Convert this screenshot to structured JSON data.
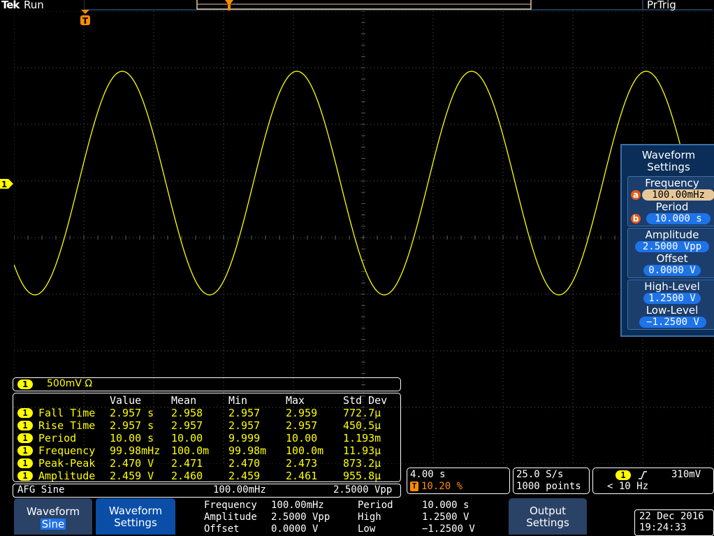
{
  "header": {
    "brand": "Tek",
    "run_state": "Run",
    "trigger_mode": "PrTrig"
  },
  "trigger_marker": "T",
  "channel1_marker": "1",
  "colors": {
    "trace": "#ffff00",
    "grid": "#5a5a5a",
    "menu_bg": "#0a2e58",
    "accent": "#1e73e8",
    "knob": "#e85a16"
  },
  "scale_bar": {
    "channel": "1",
    "scale": "500mV Ω"
  },
  "measurements": {
    "headers": [
      "Value",
      "Mean",
      "Min",
      "Max",
      "Std Dev"
    ],
    "rows": [
      {
        "channel": "1",
        "name": "Fall Time",
        "value": "2.957 s",
        "mean": "2.958",
        "min": "2.957",
        "max": "2.959",
        "std": "772.7µ"
      },
      {
        "channel": "1",
        "name": "Rise Time",
        "value": "2.957 s",
        "mean": "2.957",
        "min": "2.957",
        "max": "2.957",
        "std": "450.5µ"
      },
      {
        "channel": "1",
        "name": "Period",
        "value": "10.00 s",
        "mean": "10.00",
        "min": "9.999",
        "max": "10.00",
        "std": "1.193m"
      },
      {
        "channel": "1",
        "name": "Frequency",
        "value": "99.98mHz",
        "mean": "100.0m",
        "min": "99.98m",
        "max": "100.0m",
        "std": "11.93µ"
      },
      {
        "channel": "1",
        "name": "Peak-Peak",
        "value": "2.470 V",
        "mean": "2.471",
        "min": "2.470",
        "max": "2.473",
        "std": "873.2µ"
      },
      {
        "channel": "1",
        "name": "Amplitude",
        "value": "2.459 V",
        "mean": "2.460",
        "min": "2.459",
        "max": "2.461",
        "std": "955.8µ"
      }
    ]
  },
  "afg_bar": {
    "label": "AFG Sine",
    "frequency": "100.00mHz",
    "amplitude": "2.5000 Vpp"
  },
  "timebase": {
    "scale": "4.00 s",
    "trigger_marker": "T",
    "trigger_position": "10.20 %"
  },
  "acquisition": {
    "sample_rate": "25.0 S/s",
    "record_length": "1000 points"
  },
  "trigger": {
    "channel": "1",
    "slope_icon": "rising-edge",
    "level": "310mV",
    "freq": "< 10 Hz"
  },
  "bottom": {
    "waveform_label": "Waveform",
    "waveform_value": "Sine",
    "waveform_settings": [
      "Waveform",
      "Settings"
    ],
    "params": [
      {
        "label": "Frequency",
        "value": "100.00mHz"
      },
      {
        "label": "Amplitude",
        "value": "2.5000 Vpp"
      },
      {
        "label": "Offset",
        "value": "0.0000 V"
      }
    ],
    "params2": [
      {
        "label": "Period",
        "value": "10.000 s"
      },
      {
        "label": "High",
        "value": "1.2500 V"
      },
      {
        "label": "Low",
        "value": "−1.2500 V"
      }
    ],
    "output_settings": [
      "Output",
      "Settings"
    ],
    "date": "22 Dec 2016",
    "time": "19:24:33"
  },
  "side_menu": {
    "title": [
      "Waveform",
      "Settings"
    ],
    "frequency_label": "Frequency",
    "frequency_knob": "a",
    "frequency_value": "100.00mHz",
    "period_label": "Period",
    "period_knob": "b",
    "period_value": "10.000 s",
    "amplitude_label": "Amplitude",
    "amplitude_value": "2.5000 Vpp",
    "offset_label": "Offset",
    "offset_value": "0.0000 V",
    "high_label": "High-Level",
    "high_value": "1.2500 V",
    "low_label": "Low-Level",
    "low_value": "−1.2500 V"
  }
}
